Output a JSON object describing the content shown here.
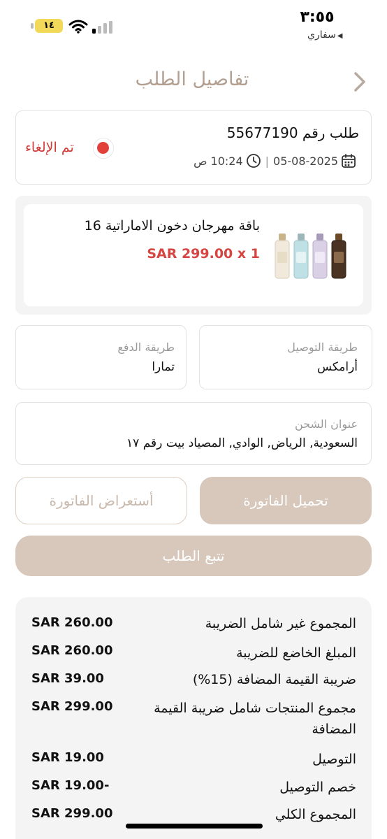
{
  "status_bar": {
    "time": "٣:٥٥",
    "battery": "١٤",
    "back_app": "سفاري"
  },
  "header": {
    "title": "تفاصيل الطلب"
  },
  "order": {
    "number_label": "طلب رقم 55677190",
    "status": "تم الإلغاء",
    "date": "05-08-2025",
    "separator": "|",
    "time": "10:24 ص"
  },
  "product": {
    "name": "باقة مهرجان دخون الاماراتية 16",
    "price": "SAR 299.00 x 1"
  },
  "shipping_method": {
    "label": "طريقة التوصيل",
    "value": "أرامكس"
  },
  "payment_method": {
    "label": "طريقة الدفع",
    "value": "تمارا"
  },
  "shipping_address": {
    "label": "عنوان الشحن",
    "value": "السعودية, الرياض, الوادي, المصياد  بيت رقم ١٧"
  },
  "actions": {
    "download_invoice": "تحميل الفاتورة",
    "view_invoice": "أستعراض الفاتورة",
    "track_order": "تتبع الطلب"
  },
  "summary": {
    "rows": [
      {
        "label": "المجموع غير شامل الضريبة",
        "value": "SAR 260.00"
      },
      {
        "label": "المبلغ الخاضع للضريبة",
        "value": "SAR 260.00"
      },
      {
        "label": "ضريبة القيمة المضافة (15%)",
        "value": "SAR 39.00"
      },
      {
        "label": "مجموع المنتجات شامل ضريبة القيمة المضافة",
        "value": "SAR 299.00"
      },
      {
        "label": "التوصيل",
        "value": "SAR 19.00"
      },
      {
        "label": "خصم التوصيل",
        "value": "SAR 19.00-"
      },
      {
        "label": "المجموع الكلي",
        "value": "SAR 299.00"
      }
    ]
  },
  "colors": {
    "accent": "#d7c8bb",
    "title": "#b29f90",
    "cancel": "#e2403b",
    "price": "#d64541"
  }
}
